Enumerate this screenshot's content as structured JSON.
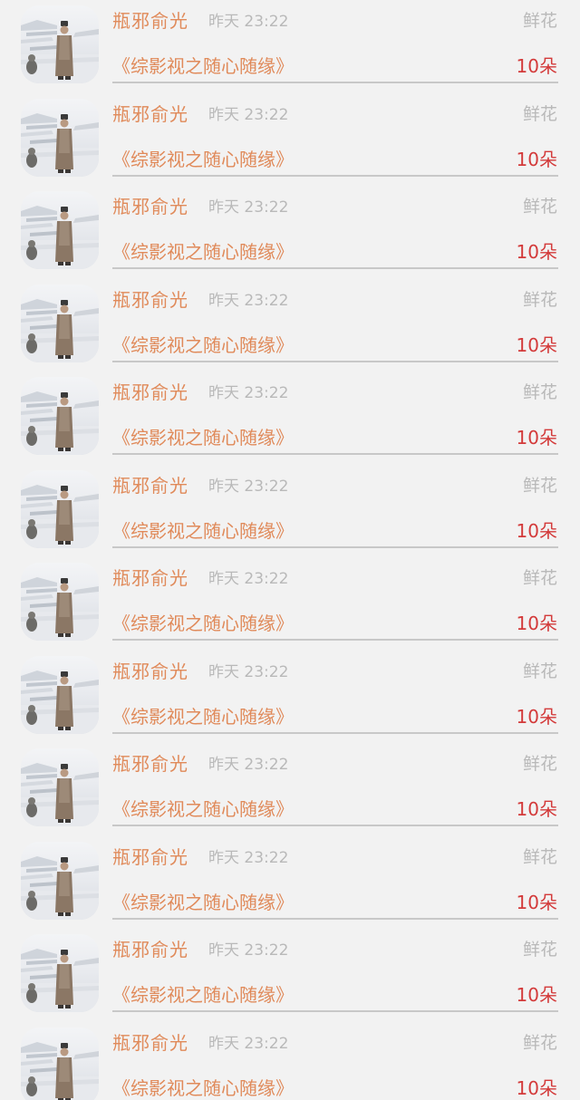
{
  "rows": [
    {
      "name": "瓶邪俞光",
      "time": "昨天 23:22",
      "gift_type": "鲜花",
      "book": "《综影视之随心随缘》",
      "count": "10朵"
    },
    {
      "name": "瓶邪俞光",
      "time": "昨天 23:22",
      "gift_type": "鲜花",
      "book": "《综影视之随心随缘》",
      "count": "10朵"
    },
    {
      "name": "瓶邪俞光",
      "time": "昨天 23:22",
      "gift_type": "鲜花",
      "book": "《综影视之随心随缘》",
      "count": "10朵"
    },
    {
      "name": "瓶邪俞光",
      "time": "昨天 23:22",
      "gift_type": "鲜花",
      "book": "《综影视之随心随缘》",
      "count": "10朵"
    },
    {
      "name": "瓶邪俞光",
      "time": "昨天 23:22",
      "gift_type": "鲜花",
      "book": "《综影视之随心随缘》",
      "count": "10朵"
    },
    {
      "name": "瓶邪俞光",
      "time": "昨天 23:22",
      "gift_type": "鲜花",
      "book": "《综影视之随心随缘》",
      "count": "10朵"
    },
    {
      "name": "瓶邪俞光",
      "time": "昨天 23:22",
      "gift_type": "鲜花",
      "book": "《综影视之随心随缘》",
      "count": "10朵"
    },
    {
      "name": "瓶邪俞光",
      "time": "昨天 23:22",
      "gift_type": "鲜花",
      "book": "《综影视之随心随缘》",
      "count": "10朵"
    },
    {
      "name": "瓶邪俞光",
      "time": "昨天 23:22",
      "gift_type": "鲜花",
      "book": "《综影视之随心随缘》",
      "count": "10朵"
    },
    {
      "name": "瓶邪俞光",
      "time": "昨天 23:22",
      "gift_type": "鲜花",
      "book": "《综影视之随心随缘》",
      "count": "10朵"
    },
    {
      "name": "瓶邪俞光",
      "time": "昨天 23:22",
      "gift_type": "鲜花",
      "book": "《综影视之随心随缘》",
      "count": "10朵"
    },
    {
      "name": "瓶邪俞光",
      "time": "昨天 23:22",
      "gift_type": "鲜花",
      "book": "《综影视之随心随缘》",
      "count": "10朵"
    }
  ],
  "colors": {
    "name": "#e08a5a",
    "book": "#e08a5a",
    "muted": "#b9b9b9",
    "count": "#d33a3a",
    "divider": "#c8c8c8",
    "background": "#f2f2f2"
  },
  "icons": {
    "avatar": "avatar-snow-palace-figure"
  }
}
